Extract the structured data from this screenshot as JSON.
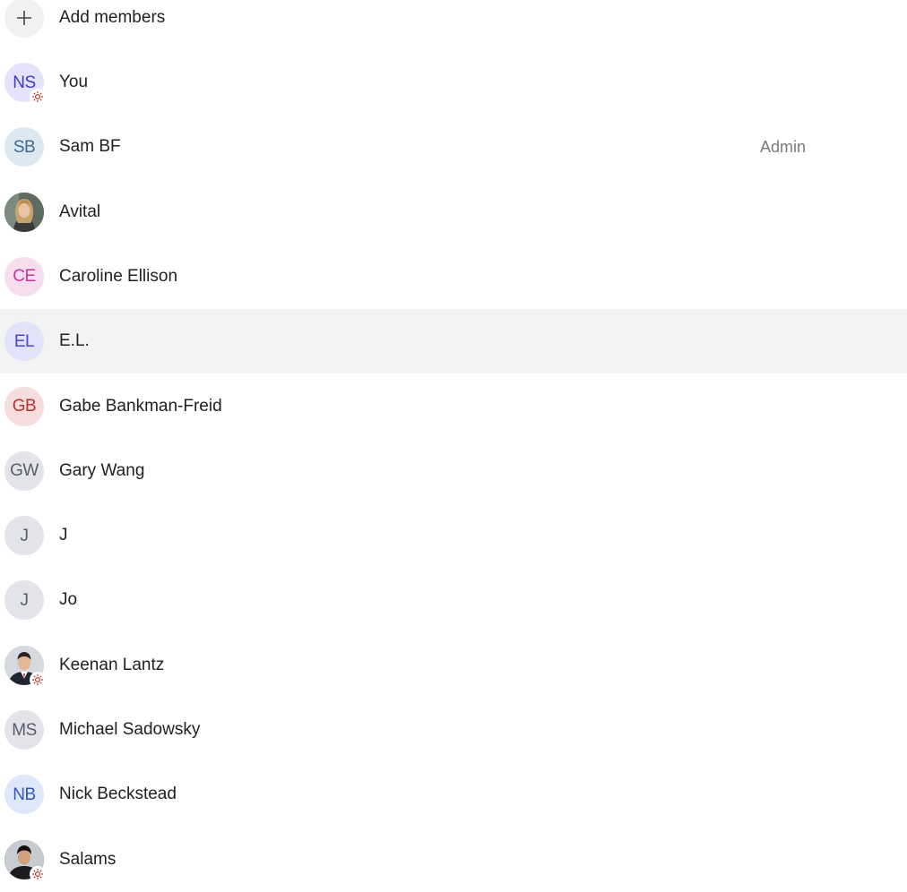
{
  "add_members": {
    "label": "Add members",
    "icon": "plus-icon"
  },
  "members": [
    {
      "name": "You",
      "initials": "NS",
      "avatar_bg": "#e4e3fb",
      "avatar_fg": "#3f3ac9",
      "photo": false,
      "external_badge": true,
      "role": ""
    },
    {
      "name": "Sam BF",
      "initials": "SB",
      "avatar_bg": "#dde8f0",
      "avatar_fg": "#3d6b8f",
      "photo": false,
      "external_badge": false,
      "role": "Admin"
    },
    {
      "name": "Avital",
      "initials": "",
      "avatar_bg": "#6b7b6e",
      "avatar_fg": "#ffffff",
      "photo": true,
      "photo_kind": "woman-portrait",
      "external_badge": false,
      "role": ""
    },
    {
      "name": "Caroline Ellison",
      "initials": "CE",
      "avatar_bg": "#f6ddef",
      "avatar_fg": "#c2389a",
      "photo": false,
      "external_badge": false,
      "role": ""
    },
    {
      "name": "E.L.",
      "initials": "EL",
      "avatar_bg": "#e2e2fb",
      "avatar_fg": "#4b45d6",
      "photo": false,
      "external_badge": false,
      "role": "",
      "highlighted": true
    },
    {
      "name": "Gabe Bankman-Freid",
      "initials": "GB",
      "avatar_bg": "#f6dddd",
      "avatar_fg": "#b8322f",
      "photo": false,
      "external_badge": false,
      "role": ""
    },
    {
      "name": "Gary Wang",
      "initials": "GW",
      "avatar_bg": "#e3e3ea",
      "avatar_fg": "#5b5b6e",
      "photo": false,
      "external_badge": false,
      "role": ""
    },
    {
      "name": "J",
      "initials": "J",
      "avatar_bg": "#e3e3ea",
      "avatar_fg": "#5b5b6e",
      "photo": false,
      "external_badge": false,
      "role": ""
    },
    {
      "name": "Jo",
      "initials": "J",
      "avatar_bg": "#e3e3ea",
      "avatar_fg": "#5b5b6e",
      "photo": false,
      "external_badge": false,
      "role": ""
    },
    {
      "name": "Keenan Lantz",
      "initials": "",
      "avatar_bg": "#c9ced6",
      "avatar_fg": "#ffffff",
      "photo": true,
      "photo_kind": "man-suit-portrait",
      "external_badge": true,
      "role": ""
    },
    {
      "name": "Michael Sadowsky",
      "initials": "MS",
      "avatar_bg": "#e3e3ea",
      "avatar_fg": "#5b5b6e",
      "photo": false,
      "external_badge": false,
      "role": ""
    },
    {
      "name": "Nick Beckstead",
      "initials": "NB",
      "avatar_bg": "#dfe8fb",
      "avatar_fg": "#2f57c2",
      "photo": false,
      "external_badge": false,
      "role": ""
    },
    {
      "name": "Salams",
      "initials": "",
      "avatar_bg": "#3b3f44",
      "avatar_fg": "#ffffff",
      "photo": true,
      "photo_kind": "man-dark-portrait",
      "external_badge": true,
      "role": ""
    }
  ],
  "colors": {
    "badge_icon": "#c0392b",
    "row_hover": "#f3f3f3",
    "role_text": "#7a7a7a"
  }
}
